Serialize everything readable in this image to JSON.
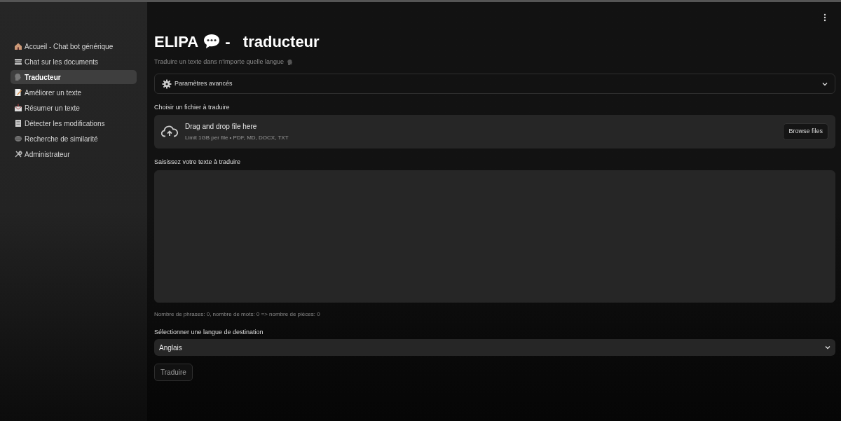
{
  "sidebar": {
    "items": [
      {
        "label": "Accueil - Chat bot générique",
        "selected": false
      },
      {
        "label": "Chat sur les documents",
        "selected": false
      },
      {
        "label": "Traducteur",
        "selected": true
      },
      {
        "label": "Améliorer un texte",
        "selected": false
      },
      {
        "label": "Résumer un texte",
        "selected": false
      },
      {
        "label": "Détecter les modifications",
        "selected": false
      },
      {
        "label": "Recherche de similarité",
        "selected": false
      },
      {
        "label": "Administrateur",
        "selected": false
      }
    ]
  },
  "title": {
    "before": "ELIPA",
    "after": "-   traducteur"
  },
  "subtitle": "Traduire un texte dans n'importe quelle langue",
  "expander": {
    "label": "Paramètres avancés",
    "expanded": false
  },
  "uploader": {
    "label": "Choisir un fichier à traduire",
    "drop_text": "Drag and drop file here",
    "limits": "Limit 1GB per file • PDF, MD, DOCX, TXT",
    "button": "Browse files"
  },
  "text_input": {
    "label": "Saisissez votre texte à traduire"
  },
  "counter": "Nombre de phrases: 0, nombre de mots: 0 => nombre de pièces: 0",
  "language_select": {
    "label": "Sélectionner une langue de destination",
    "value": "Anglais"
  },
  "submit_button": "Traduire"
}
